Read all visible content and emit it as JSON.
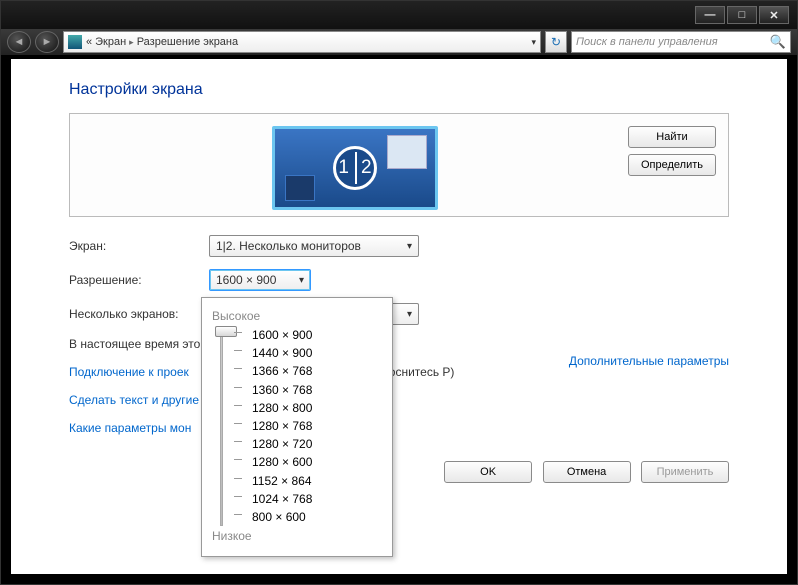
{
  "titlebar": {
    "min": "—",
    "max": "□",
    "close": "✕"
  },
  "nav": {
    "chev_prefix": "«",
    "crumb1": "Экран",
    "sep": "▸",
    "crumb2": "Разрешение экрана",
    "search_placeholder": "Поиск в панели управления",
    "search_icon": "🔍"
  },
  "page": {
    "title": "Настройки экрана",
    "find_btn": "Найти",
    "identify_btn": "Определить",
    "labels": {
      "display": "Экран:",
      "resolution": "Разрешение:",
      "multiple": "Несколько экранов:"
    },
    "combos": {
      "display": "1|2. Несколько мониторов",
      "resolution": "1600 × 900",
      "multiple": ""
    },
    "note": "В настоящее время это",
    "note_tail": "оснитесь P)",
    "links": {
      "projector": "Подключение к проек",
      "text_size": "Сделать текст и другие",
      "which_params": "Какие параметры мон",
      "advanced": "Дополнительные параметры"
    },
    "buttons": {
      "ok": "OK",
      "cancel": "Отмена",
      "apply": "Применить"
    },
    "monitor_numbers": "1 2"
  },
  "popup": {
    "high": "Высокое",
    "low": "Низкое",
    "resolutions": [
      "1600 × 900",
      "1440 × 900",
      "1366 × 768",
      "1360 × 768",
      "1280 × 800",
      "1280 × 768",
      "1280 × 720",
      "1280 × 600",
      "1152 × 864",
      "1024 × 768",
      "800 × 600"
    ]
  }
}
